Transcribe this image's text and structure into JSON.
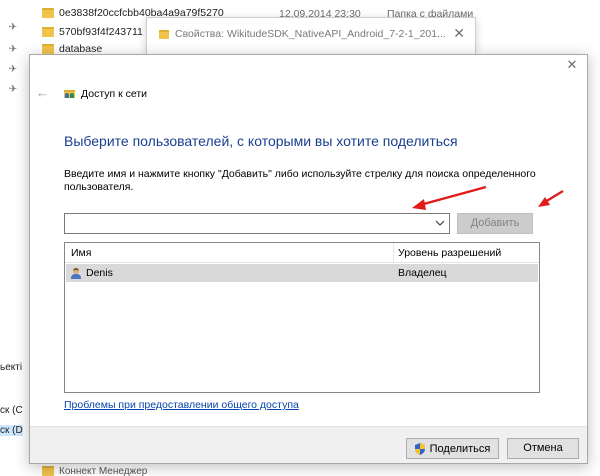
{
  "explorer": {
    "rows": [
      {
        "name": "0e3838f20ccfcbb40ba4a9a79f5270",
        "date": "12.09.2014 23:30",
        "type": "Папка с файлами"
      },
      {
        "name": "570bf93f4f243711"
      },
      {
        "name": "database"
      }
    ],
    "left_labels": [
      {
        "text": "ьекті"
      },
      {
        "text": "ск (C"
      },
      {
        "text": "ск (D"
      }
    ],
    "bottom_row": {
      "name": "Коннект Менеджер"
    }
  },
  "properties_window": {
    "title": "Свойства: WikitudeSDK_NativeAPI_Android_7-2-1_201..."
  },
  "dialog": {
    "title": "Доступ к сети",
    "heading": "Выберите пользователей, с которыми вы хотите поделиться",
    "instruction": "Введите имя и нажмите кнопку \"Добавить\" либо используйте стрелку для поиска определенного пользователя.",
    "user_input": {
      "value": "",
      "placeholder": ""
    },
    "add_label": "Добавить",
    "table": {
      "columns": [
        "Имя",
        "Уровень разрешений"
      ],
      "rows": [
        {
          "name": "Denis",
          "permission": "Владелец"
        }
      ]
    },
    "help_link": "Проблемы при предоставлении общего доступа",
    "share_label": "Поделиться",
    "cancel_label": "Отмена"
  },
  "colors": {
    "heading": "#1a3f8f",
    "link": "#0645ad",
    "selected_row": "#d9d9d9",
    "annotation_arrow": "#e01b1b"
  }
}
